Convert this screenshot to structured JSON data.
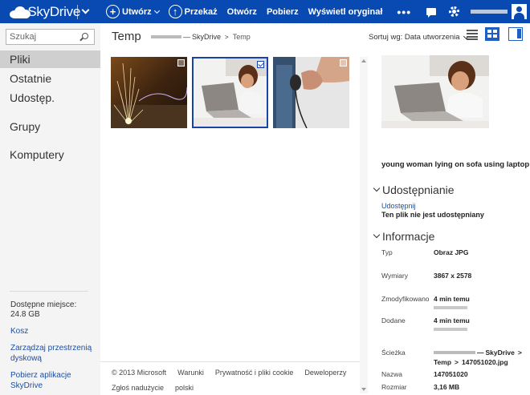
{
  "topbar": {
    "logo_text": "SkyDrive",
    "commands": [
      {
        "label": "Utwórz",
        "icon": "plus-circle-icon"
      },
      {
        "label": "Przekaż",
        "icon": "upload-circle-icon"
      },
      {
        "label": "Otwórz"
      },
      {
        "label": "Pobierz"
      },
      {
        "label": "Wyświetl oryginał"
      }
    ],
    "more": "•••"
  },
  "sidebar": {
    "search_placeholder": "Szukaj",
    "items": [
      {
        "label": "Pliki"
      },
      {
        "label": "Ostatnie"
      },
      {
        "label": "Udostęp."
      },
      {
        "label": "Grupy"
      },
      {
        "label": "Komputery"
      }
    ],
    "storage_label": "Dostępne miejsce:",
    "storage_value": "24.8 GB",
    "links": [
      "Kosz",
      "Zarządzaj przestrzenią dyskową",
      "Pobierz aplikacje SkyDrive"
    ]
  },
  "main": {
    "folder_title": "Temp",
    "breadcrumb": {
      "drive": "SkyDrive",
      "folder": "Temp"
    },
    "sort_label": "Sortuj wg: Data utworzenia"
  },
  "footer": {
    "row1": [
      "© 2013 Microsoft",
      "Warunki",
      "Prywatność i pliki cookie",
      "Deweloperzy"
    ],
    "row2": [
      "Zgłoś nadużycie",
      "polski"
    ]
  },
  "details": {
    "file_title": "young woman lying on sofa using laptop",
    "sharing_header": "Udostępnianie",
    "share_link": "Udostępnij",
    "share_status": "Ten plik nie jest udostępniany",
    "info_header": "Informacje",
    "type_label": "Typ",
    "type_value": "Obraz JPG",
    "dims_label": "Wymiary",
    "dims_value": "3867 x 2578",
    "modified_label": "Zmodyfikowano",
    "modified_value": "4 min temu",
    "added_label": "Dodane",
    "added_value": "4 min temu",
    "path_label": "Ścieżka",
    "path_drive": "SkyDrive",
    "path_folder": "Temp",
    "path_file": "147051020.jpg",
    "name_label": "Nazwa",
    "name_value": "147051020",
    "size_label": "Rozmiar",
    "size_value": "3,16 MB"
  },
  "colors": {
    "brand": "#094ab2",
    "selected": "#1845a5",
    "link": "#1e4fa3"
  }
}
